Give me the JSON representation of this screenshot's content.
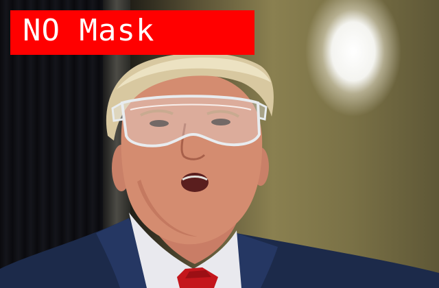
{
  "photo": {
    "subject": "person-wearing-safety-goggles-no-face-mask"
  },
  "detection": {
    "label": "NO Mask",
    "box_color": "#ff0000",
    "text_color": "#ffffff"
  }
}
